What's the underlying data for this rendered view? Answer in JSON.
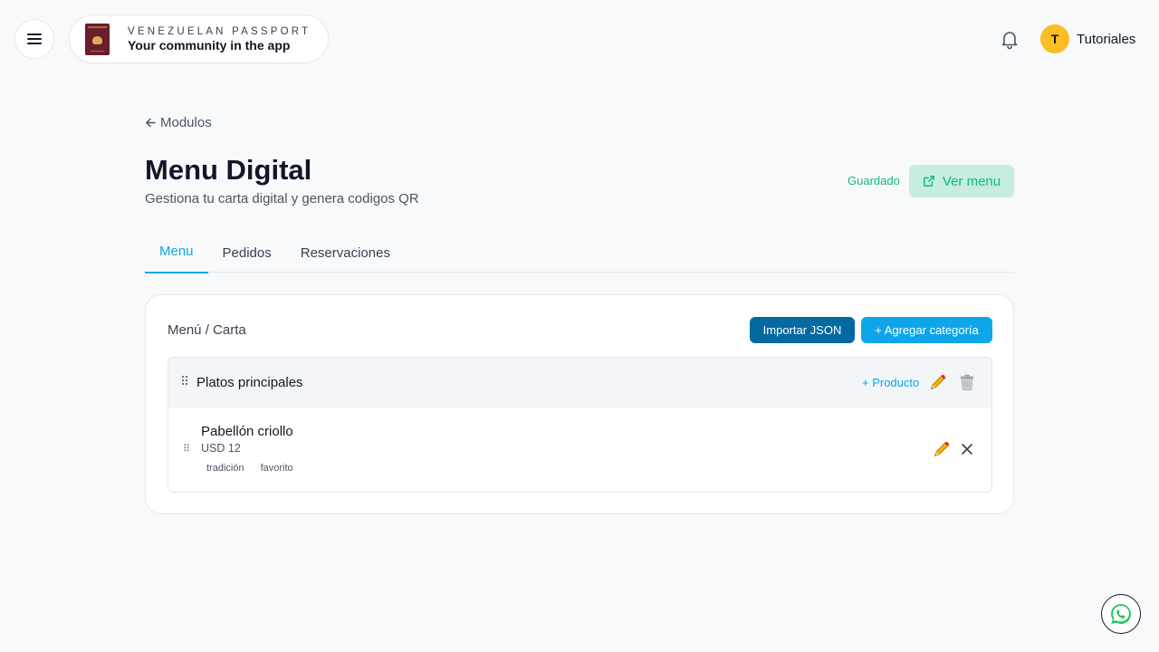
{
  "header": {
    "brand_line1": "VENEZUELAN PASSPORT",
    "brand_line2": "Your community in the app",
    "user_initial": "T",
    "user_name": "Tutoriales"
  },
  "nav": {
    "back_label": "Modulos"
  },
  "page": {
    "title": "Menu Digital",
    "subtitle": "Gestiona tu carta digital y genera codigos QR",
    "status": "Guardado",
    "view_menu_label": "Ver menu"
  },
  "tabs": [
    {
      "label": "Menu",
      "active": true
    },
    {
      "label": "Pedidos",
      "active": false
    },
    {
      "label": "Reservaciones",
      "active": false
    }
  ],
  "card": {
    "title": "Menú / Carta",
    "import_label": "Importar JSON",
    "add_category_label": "+ Agregar categoría",
    "category": {
      "name": "Platos principales",
      "add_product_label": "+ Producto",
      "products": [
        {
          "name": "Pabellón criollo",
          "price": "USD 12",
          "tags": [
            "tradición",
            "favorito"
          ]
        }
      ]
    }
  },
  "colors": {
    "accent": "#0ea5e9",
    "primary_dark": "#0369a1",
    "success": "#10b981",
    "success_bg": "#c6ede0",
    "avatar": "#fbbf24"
  },
  "icons": [
    "hamburger-icon",
    "passport-icon",
    "bell-icon",
    "arrow-left-icon",
    "external-link-icon",
    "drag-handle-icon",
    "pencil-icon",
    "trash-icon",
    "close-icon",
    "whatsapp-icon"
  ]
}
